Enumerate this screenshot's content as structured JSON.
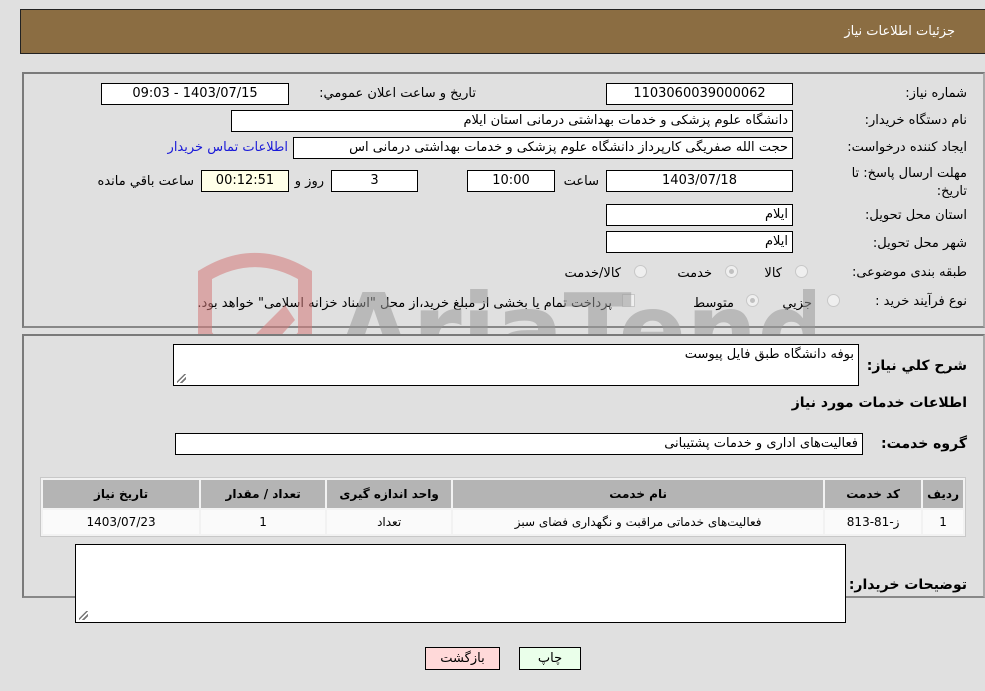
{
  "header": {
    "title": "جزئیات اطلاعات نیاز"
  },
  "form": {
    "need_number": {
      "label": "شماره نیاز:",
      "value": "1103060039000062"
    },
    "announce_datetime": {
      "label": "تاريخ و ساعت اعلان عمومي:",
      "value": "1403/07/15 - 09:03"
    },
    "buyer_org": {
      "label": "نام دستگاه خریدار:",
      "value": "دانشگاه علوم پزشکی و خدمات بهداشتی درمانی استان ایلام"
    },
    "requester": {
      "label": "ایجاد کننده درخواست:",
      "value": "حجت الله صفریگی کارپرداز دانشگاه علوم پزشکی و خدمات بهداشتی درمانی اس",
      "contact_link": "اطلاعات تماس خریدار"
    },
    "deadline": {
      "label": "مهلت ارسال پاسخ: تا تاریخ:",
      "date": "1403/07/18",
      "time_label": "ساعت",
      "time": "10:00",
      "days": "3",
      "days_label": "روز و",
      "remaining": "00:12:51",
      "remaining_label": "ساعت باقي مانده"
    },
    "delivery_province": {
      "label": "استان محل تحویل:",
      "value": "ایلام"
    },
    "delivery_city": {
      "label": "شهر محل تحویل:",
      "value": "ایلام"
    },
    "category": {
      "label": "طبقه بندی موضوعی:",
      "options": [
        "کالا",
        "خدمت",
        "کالا/خدمت"
      ],
      "selected": "خدمت"
    },
    "purchase_type": {
      "label": "نوع فرآیند خرید :",
      "options": [
        "جزيي",
        "متوسط"
      ],
      "selected": "متوسط",
      "treasury_note": "پرداخت تمام یا بخشی از مبلغ خرید،از محل \"اسناد خزانه اسلامی\" خواهد بود."
    }
  },
  "details": {
    "description_label": "شرح کلي نياز:",
    "description_value": "بوفه دانشگاه طبق فایل پیوست",
    "services_heading": "اطلاعات خدمات مورد نیاز",
    "service_group_label": "گروه خدمت:",
    "service_group_value": "فعالیت‌های اداری و خدمات پشتیبانی",
    "table": {
      "headers": [
        "ردیف",
        "کد خدمت",
        "نام خدمت",
        "واحد اندازه گیری",
        "تعداد / مقدار",
        "تاریخ نیاز"
      ],
      "rows": [
        [
          "1",
          "ز-81-813",
          "فعالیت‌های خدماتی مراقبت و نگهداری فضای سبز",
          "تعداد",
          "1",
          "1403/07/23"
        ]
      ]
    },
    "buyer_notes_label": "توضیحات خریدار:",
    "buyer_notes_value": ""
  },
  "buttons": {
    "print": "چاپ",
    "back": "بازگشت"
  },
  "watermark": {
    "text": "AriaTender.neT"
  },
  "colors": {
    "header_bg": "#8b6d42",
    "link": "#1a1ad8",
    "back_btn": "#ffd9d9",
    "print_btn": "#eaffea",
    "remaining_bg": "#ffffe8"
  }
}
